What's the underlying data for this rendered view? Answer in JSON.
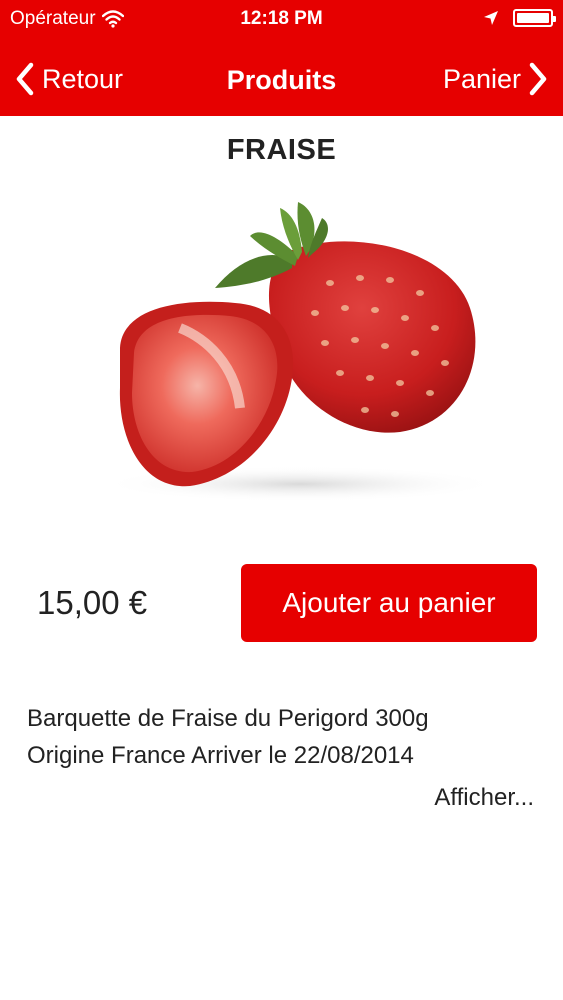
{
  "status_bar": {
    "carrier": "Opérateur",
    "time": "12:18 PM",
    "icons": [
      "wifi-icon",
      "location-arrow-icon",
      "battery-icon"
    ]
  },
  "nav": {
    "back_label": "Retour",
    "title": "Produits",
    "forward_label": "Panier",
    "icons": [
      "chevron-left-icon",
      "chevron-right-icon"
    ]
  },
  "product": {
    "name": "FRAISE",
    "image": "strawberry-image",
    "price": "15,00 €",
    "add_to_cart_label": "Ajouter au panier",
    "description_line1": "Barquette de Fraise du Perigord 300g",
    "description_line2": "Origine France Arriver le 22/08/2014",
    "show_more_label": "Afficher..."
  },
  "colors": {
    "accent": "#e60000",
    "text": "#222222",
    "background": "#ffffff"
  }
}
